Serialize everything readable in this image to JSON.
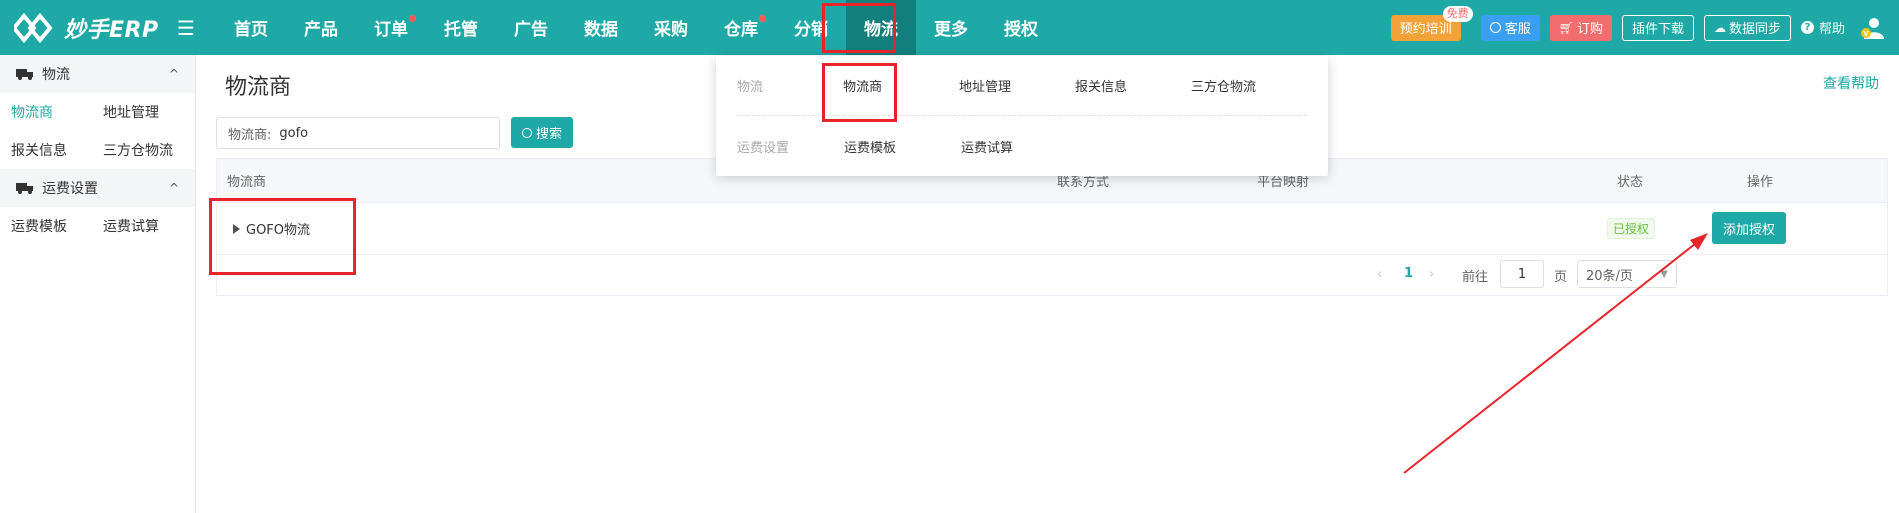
{
  "logo": {
    "text": "妙手ERP"
  },
  "nav": [
    {
      "label": "首页",
      "dot": false,
      "active": false
    },
    {
      "label": "产品",
      "dot": false,
      "active": false
    },
    {
      "label": "订单",
      "dot": true,
      "active": false
    },
    {
      "label": "托管",
      "dot": false,
      "active": false
    },
    {
      "label": "广告",
      "dot": false,
      "active": false
    },
    {
      "label": "数据",
      "dot": false,
      "active": false
    },
    {
      "label": "采购",
      "dot": false,
      "active": false
    },
    {
      "label": "仓库",
      "dot": true,
      "active": false
    },
    {
      "label": "分销",
      "dot": false,
      "active": false
    },
    {
      "label": "物流",
      "dot": false,
      "active": true
    },
    {
      "label": "更多",
      "dot": false,
      "active": false
    },
    {
      "label": "授权",
      "dot": false,
      "active": false
    }
  ],
  "tools": {
    "training": "预约培训",
    "free_badge": "免费",
    "service": "客服",
    "subscribe": "订购",
    "plugin": "插件下载",
    "sync": "数据同步",
    "help": "帮助"
  },
  "sidebar": {
    "group1": {
      "label": "物流",
      "chevron": "^"
    },
    "group1_items": [
      [
        "物流商",
        "地址管理"
      ],
      [
        "报关信息",
        "三方仓物流"
      ]
    ],
    "group2": {
      "label": "运费设置",
      "chevron": "^"
    },
    "group2_items": [
      [
        "运费模板",
        "运费试算"
      ]
    ]
  },
  "main": {
    "title": "物流商",
    "help_link": "查看帮助",
    "search_label": "物流商:",
    "search_value": "gofo",
    "search_button": "搜索"
  },
  "table": {
    "headers": {
      "name": "物流商",
      "contact": "联系方式",
      "platform": "平台映射",
      "status": "状态",
      "ops": "操作"
    },
    "rows": [
      {
        "name": "GOFO物流",
        "status": "已授权",
        "action": "添加授权"
      }
    ]
  },
  "pager": {
    "prev": "‹",
    "current": "1",
    "next": "›",
    "goto": "前往",
    "page_value": "1",
    "unit": "页",
    "size": "20条/页"
  },
  "dropdown": {
    "row1": {
      "category": "物流",
      "items": [
        "物流商",
        "地址管理",
        "报关信息",
        "三方仓物流"
      ]
    },
    "row2": {
      "category": "运费设置",
      "items": [
        "运费模板",
        "运费试算"
      ]
    }
  },
  "colors": {
    "brand": "#1fa9a6",
    "nav_active": "#127f7c",
    "annotation": "#e8242b"
  }
}
